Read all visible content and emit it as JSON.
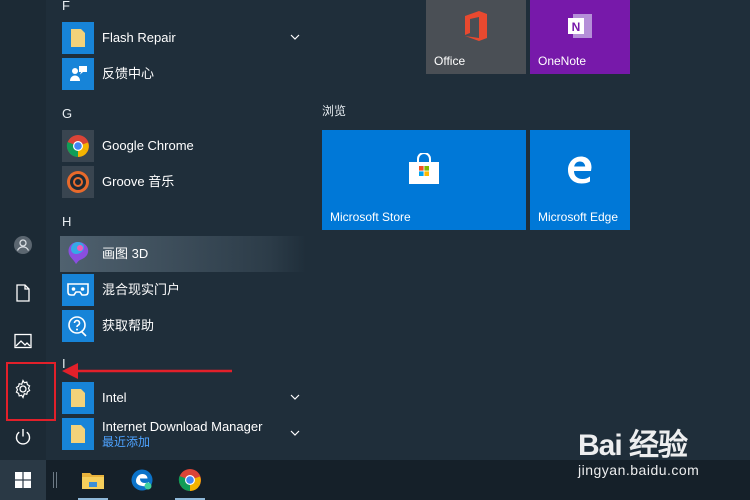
{
  "applist": {
    "letter_f": "F",
    "letter_g": "G",
    "letter_h": "H",
    "letter_i": "I",
    "apps": [
      {
        "label": "Flash Repair"
      },
      {
        "label": "反馈中心"
      },
      {
        "label": "Google Chrome"
      },
      {
        "label": "Groove 音乐"
      },
      {
        "label": "画图 3D"
      },
      {
        "label": "混合现实门户"
      },
      {
        "label": "获取帮助"
      },
      {
        "label": "Intel"
      },
      {
        "label": "Internet Download Manager",
        "sub": "最近添加"
      }
    ]
  },
  "tiles": {
    "office": "Office",
    "onenote": "OneNote",
    "group_browse": "浏览",
    "store": "Microsoft Store",
    "edge": "Microsoft Edge"
  },
  "watermark": {
    "brand": "Bai 经验",
    "url": "jingyan.baidu.com"
  },
  "colors": {
    "tile_blue": "#0078d7",
    "onenote_purple": "#7719aa",
    "office_tile": "#4a4f55",
    "highlight_red": "#e2202a"
  },
  "icons": {
    "rail": [
      "user-icon",
      "document-icon",
      "pictures-icon",
      "settings-gear-icon",
      "power-icon"
    ],
    "taskbar": [
      "windows-start-icon",
      "file-explorer-icon",
      "edge-icon",
      "chrome-icon"
    ]
  }
}
